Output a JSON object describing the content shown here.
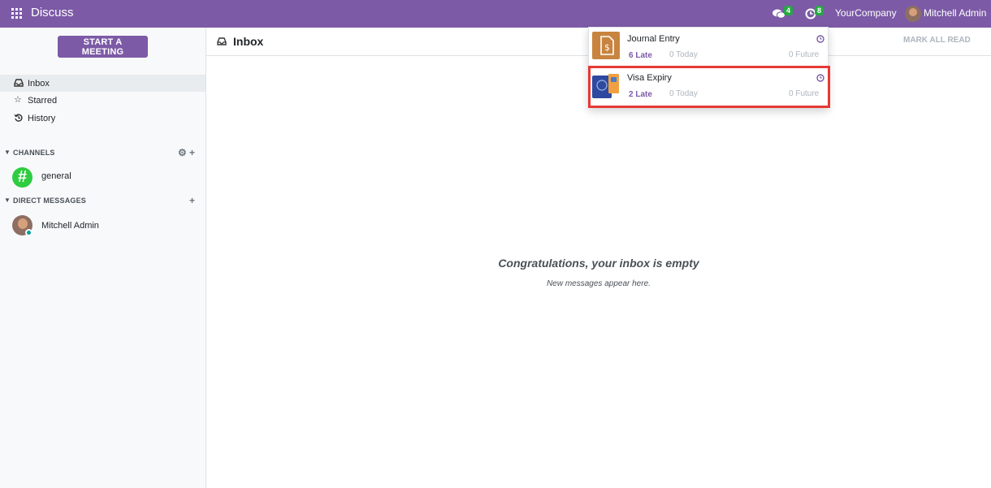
{
  "topbar": {
    "app_title": "Discuss",
    "messages_count": "4",
    "activities_count": "8",
    "company": "YourCompany",
    "user": "Mitchell Admin"
  },
  "sidebar": {
    "meeting_button": "START A MEETING",
    "nav": [
      {
        "label": "Inbox"
      },
      {
        "label": "Starred"
      },
      {
        "label": "History"
      }
    ],
    "channels_header": "CHANNELS",
    "channels": [
      {
        "label": "general"
      }
    ],
    "dm_header": "DIRECT MESSAGES",
    "dms": [
      {
        "label": "Mitchell Admin"
      }
    ]
  },
  "main": {
    "title": "Inbox",
    "mark_all_read": "MARK ALL READ",
    "empty_title": "Congratulations, your inbox is empty",
    "empty_subtitle": "New messages appear here."
  },
  "activities": [
    {
      "name": "Journal Entry",
      "late": "6 Late",
      "today": "0 Today",
      "future": "0 Future"
    },
    {
      "name": "Visa Expiry",
      "late": "2 Late",
      "today": "0 Today",
      "future": "0 Future"
    }
  ],
  "colors": {
    "brand": "#7c5aa6",
    "badge": "#28a745",
    "highlight": "#e53935"
  }
}
